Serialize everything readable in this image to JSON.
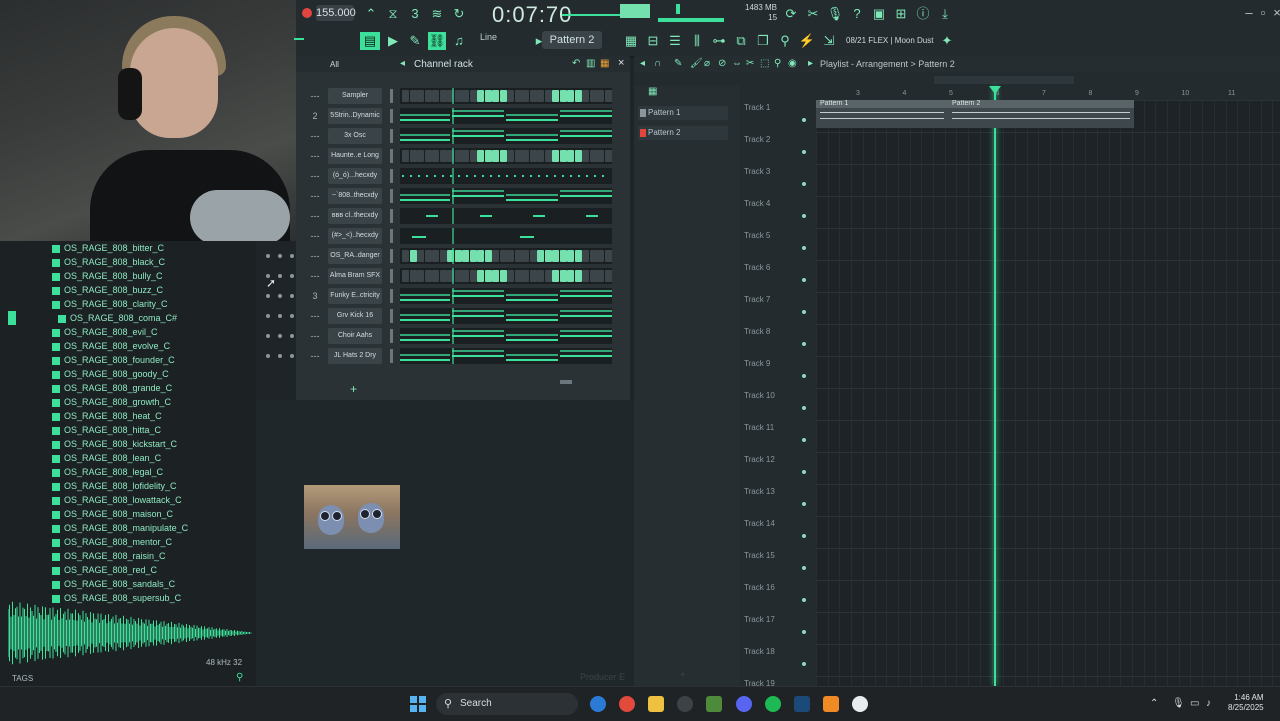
{
  "toolbar": {
    "tempo": "155.000",
    "time": "0:07:70",
    "time_label": "M:S:CS",
    "memory": "1483 MB",
    "cpu": "15",
    "pattern": "Pattern 2",
    "snap": "Line",
    "hint": "08/21  FLEX | Moon Dust"
  },
  "browser": {
    "items": [
      "OS_RAGE_808_bitter_C",
      "OS_RAGE_808_black_C",
      "OS_RAGE_808_bully_C",
      "OS_RAGE_808_buzz_C",
      "OS_RAGE_808_clarity_C",
      "OS_RAGE_808_coma_C#",
      "OS_RAGE_808_evil_C",
      "OS_RAGE_808_evolve_C",
      "OS_RAGE_808_founder_C",
      "OS_RAGE_808_goody_C",
      "OS_RAGE_808_grande_C",
      "OS_RAGE_808_growth_C",
      "OS_RAGE_808_heat_C",
      "OS_RAGE_808_hitta_C",
      "OS_RAGE_808_kickstart_C",
      "OS_RAGE_808_lean_C",
      "OS_RAGE_808_legal_C",
      "OS_RAGE_808_lofidelity_C",
      "OS_RAGE_808_lowattack_C",
      "OS_RAGE_808_maison_C",
      "OS_RAGE_808_manipulate_C",
      "OS_RAGE_808_mentor_C",
      "OS_RAGE_808_raisin_C",
      "OS_RAGE_808_red_C",
      "OS_RAGE_808_sandals_C",
      "OS_RAGE_808_supersub_C"
    ],
    "selected_index": 5,
    "sample_info": "48 kHz 32",
    "tags_label": "TAGS"
  },
  "channel_rack": {
    "filter": "All",
    "title": "Channel rack",
    "channels": [
      {
        "num": "---",
        "name": "Sampler",
        "type": "steps",
        "steps": [
          0,
          0,
          0,
          0,
          0,
          0,
          0,
          0,
          0,
          0,
          1,
          1,
          1,
          1,
          0,
          0,
          0,
          0,
          0,
          0,
          1,
          1,
          1,
          1,
          0,
          0,
          0,
          0
        ]
      },
      {
        "num": "2",
        "name": "5Strin..Dynamic",
        "type": "roll"
      },
      {
        "num": "---",
        "name": "3x Osc",
        "type": "roll"
      },
      {
        "num": "---",
        "name": "Haunte..e Long",
        "type": "steps",
        "steps": [
          0,
          0,
          0,
          0,
          0,
          0,
          0,
          0,
          0,
          0,
          1,
          1,
          1,
          1,
          0,
          0,
          0,
          0,
          0,
          0,
          1,
          1,
          1,
          1,
          0,
          0,
          0,
          0
        ]
      },
      {
        "num": "---",
        "name": "(ó_ó)...hecxdy",
        "type": "dots"
      },
      {
        "num": "---",
        "name": "~`808..thecxdy",
        "type": "roll"
      },
      {
        "num": "---",
        "name": "ʙʙʙ cl..thecxdy",
        "type": "sparse"
      },
      {
        "num": "---",
        "name": "(#>_<)..hecxdy",
        "type": "sparse2"
      },
      {
        "num": "---",
        "name": "OS_RA..danger",
        "type": "steps",
        "steps": [
          0,
          1,
          0,
          0,
          0,
          0,
          1,
          1,
          1,
          1,
          1,
          1,
          0,
          0,
          0,
          0,
          0,
          0,
          1,
          1,
          1,
          1,
          1,
          1,
          0,
          0,
          0,
          0
        ]
      },
      {
        "num": "---",
        "name": "Alma Bram SFX",
        "type": "steps",
        "steps": [
          0,
          0,
          0,
          0,
          0,
          0,
          0,
          0,
          0,
          0,
          1,
          1,
          1,
          1,
          0,
          0,
          0,
          0,
          0,
          0,
          1,
          1,
          1,
          1,
          0,
          0,
          0,
          0
        ]
      },
      {
        "num": "3",
        "name": "Funky E..ctricity",
        "type": "roll"
      },
      {
        "num": "---",
        "name": "Grv Kick 16",
        "type": "roll"
      },
      {
        "num": "---",
        "name": "Choir Aahs",
        "type": "roll"
      },
      {
        "num": "---",
        "name": "JL Hats 2 Dry",
        "type": "roll"
      }
    ]
  },
  "playlist": {
    "title": "Playlist - Arrangement  >  Pattern 2",
    "patterns": [
      "Pattern 1",
      "Pattern 2"
    ],
    "tracks": [
      "Track 1",
      "Track 2",
      "Track 3",
      "Track 4",
      "Track 5",
      "Track 6",
      "Track 7",
      "Track 8",
      "Track 9",
      "Track 10",
      "Track 11",
      "Track 12",
      "Track 13",
      "Track 14",
      "Track 15",
      "Track 16",
      "Track 17",
      "Track 18",
      "Track 19"
    ],
    "bars": [
      "3",
      "4",
      "5",
      "6",
      "7",
      "8",
      "9",
      "10",
      "11"
    ],
    "clips": [
      {
        "label": "Pattern 1"
      },
      {
        "label": "Pattern 2"
      }
    ]
  },
  "taskbar": {
    "search_placeholder": "Search",
    "time": "1:46 AM",
    "date": "8/25/2025"
  },
  "lower": {
    "producer_label": "Producer E"
  },
  "colors": {
    "accent": "#3de09a",
    "record": "#e2443e"
  }
}
